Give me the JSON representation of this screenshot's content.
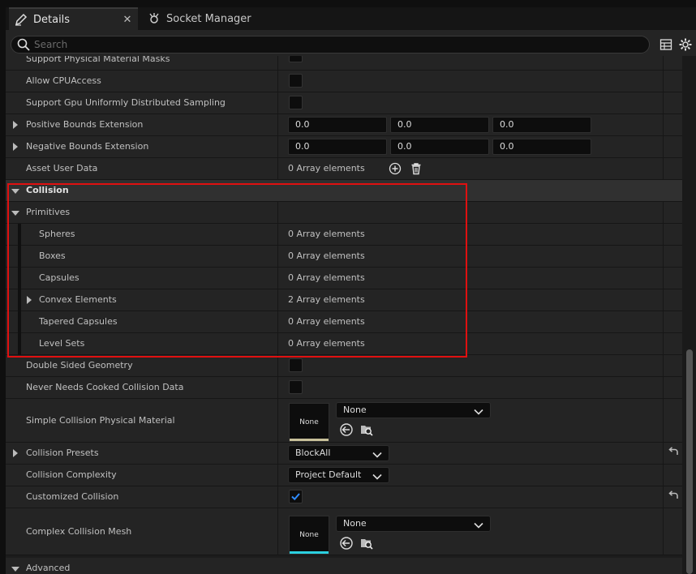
{
  "tabs": {
    "details": "Details",
    "socket_manager": "Socket Manager"
  },
  "search": {
    "placeholder": "Search"
  },
  "rows": {
    "partial": "Support Physical Material Masks",
    "allow_cpu": "Allow CPUAccess",
    "support_gpu": "Support Gpu Uniformly Distributed Sampling",
    "pos_bounds": {
      "label": "Positive Bounds Extension",
      "x": "0.0",
      "y": "0.0",
      "z": "0.0"
    },
    "neg_bounds": {
      "label": "Negative Bounds Extension",
      "x": "0.0",
      "y": "0.0",
      "z": "0.0"
    },
    "asset_user_data": {
      "label": "Asset User Data",
      "value": "0 Array elements"
    },
    "collision": "Collision",
    "primitives": "Primitives",
    "spheres": {
      "label": "Spheres",
      "value": "0 Array elements"
    },
    "boxes": {
      "label": "Boxes",
      "value": "0 Array elements"
    },
    "capsules": {
      "label": "Capsules",
      "value": "0 Array elements"
    },
    "convex": {
      "label": "Convex Elements",
      "value": "2 Array elements"
    },
    "tapered": {
      "label": "Tapered Capsules",
      "value": "0 Array elements"
    },
    "level_sets": {
      "label": "Level Sets",
      "value": "0 Array elements"
    },
    "double_sided": "Double Sided Geometry",
    "never_cooked": "Never Needs Cooked Collision Data",
    "simple_phys": {
      "label": "Simple Collision Physical Material",
      "thumb": "None",
      "combo": "None"
    },
    "presets": {
      "label": "Collision Presets",
      "value": "BlockAll"
    },
    "complexity": {
      "label": "Collision Complexity",
      "value": "Project Default"
    },
    "customized": {
      "label": "Customized Collision",
      "checked": true
    },
    "complex_mesh": {
      "label": "Complex Collision Mesh",
      "thumb": "None",
      "combo": "None"
    },
    "advanced": "Advanced"
  },
  "colors": {
    "highlight_box": "#e01010",
    "check_blue": "#2f8cff",
    "material_bar": "#c8c09a",
    "mesh_bar": "#2bd0e0"
  }
}
